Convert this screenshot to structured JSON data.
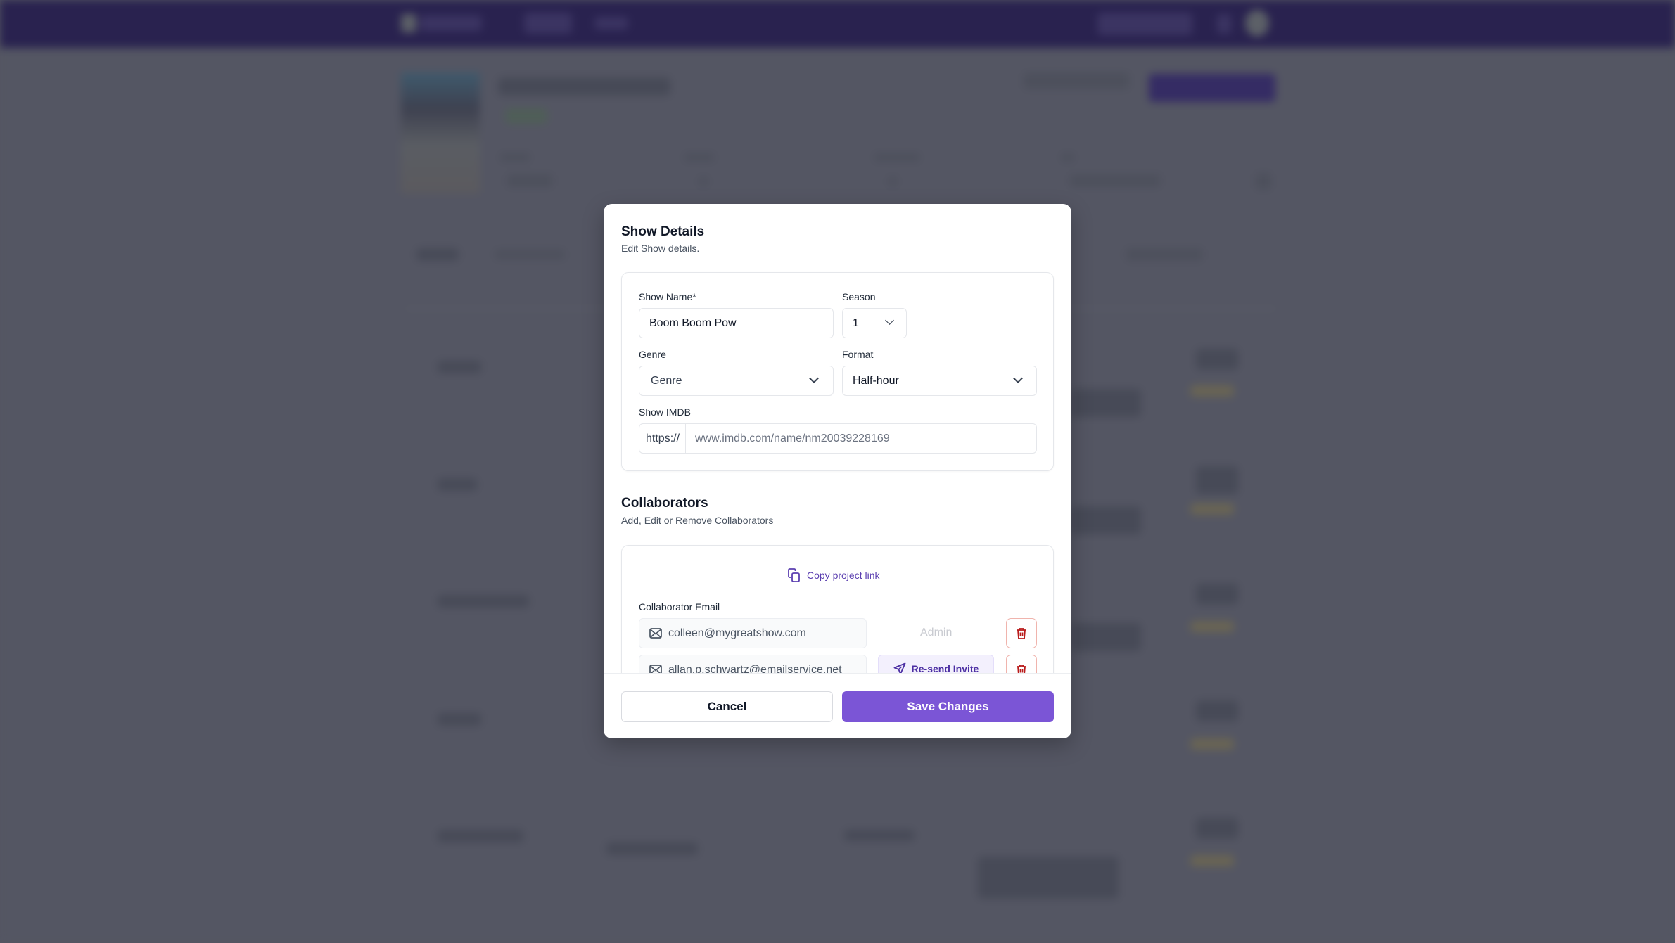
{
  "colors": {
    "brand_purple": "#7b55d6",
    "topbar": "#29224f",
    "overlay": "#545663",
    "link_purple": "#5b3fb0",
    "danger_red": "#b91c1c"
  },
  "modal": {
    "show_details": {
      "title": "Show Details",
      "subtitle": "Edit Show details.",
      "fields": {
        "show_name": {
          "label": "Show Name*",
          "value": "Boom Boom Pow"
        },
        "season": {
          "label": "Season",
          "value": "1",
          "icon": "chevron-down-icon"
        },
        "genre": {
          "label": "Genre",
          "placeholder": "Genre",
          "icon": "chevron-down-icon"
        },
        "format": {
          "label": "Format",
          "value": "Half-hour",
          "icon": "chevron-down-icon"
        },
        "imdb": {
          "label": "Show IMDB",
          "prefix": "https://",
          "value": "www.imdb.com/name/nm20039228169"
        }
      }
    },
    "collaborators": {
      "title": "Collaborators",
      "subtitle": "Add, Edit or Remove Collaborators",
      "copy_link_label": "Copy project link",
      "email_label": "Collaborator Email",
      "rows": [
        {
          "email": "colleen@mygreatshow.com",
          "role": "Admin",
          "action": null
        },
        {
          "email": "allan.p.schwartz@emailservice.net",
          "role": null,
          "action": "Re-send Invite"
        }
      ]
    },
    "footer": {
      "cancel_label": "Cancel",
      "save_label": "Save Changes"
    }
  }
}
